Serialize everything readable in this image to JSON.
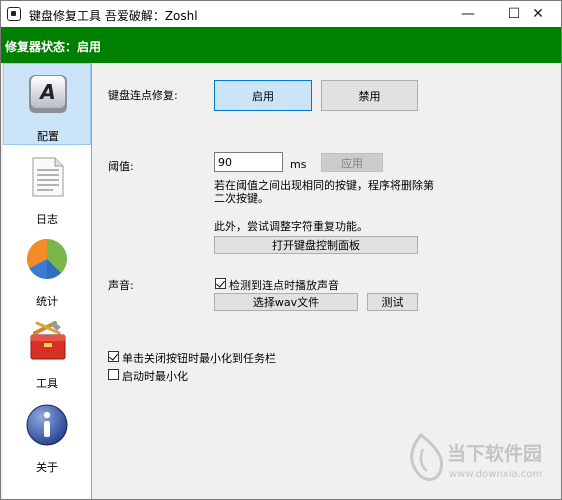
{
  "window": {
    "title": "键盘修复工具 吾爱破解：Zoshl",
    "controls": {
      "minimize": "—",
      "maximize": "☐",
      "close": "✕"
    }
  },
  "status": {
    "text": "修复器状态：启用",
    "color": "#008000"
  },
  "sidebar": {
    "items": [
      {
        "label": "配置",
        "icon": "keyboard-key-icon",
        "active": true
      },
      {
        "label": "日志",
        "icon": "document-icon",
        "active": false
      },
      {
        "label": "统计",
        "icon": "pie-chart-icon",
        "active": false
      },
      {
        "label": "工具",
        "icon": "toolbox-icon",
        "active": false
      },
      {
        "label": "关于",
        "icon": "info-icon",
        "active": false
      }
    ]
  },
  "config": {
    "chatter_label": "键盘连点修复:",
    "enable_button": "启用",
    "disable_button": "禁用",
    "threshold_label": "阈值:",
    "threshold_value": "90",
    "threshold_unit": "ms",
    "apply_button": "应用",
    "threshold_desc_line1": "若在阈值之间出现相同的按键，程序将删除第",
    "threshold_desc_line2": "二次按键。",
    "extra_note": "此外，尝试调整字符重复功能。",
    "open_keyboard_panel_button": "打开键盘控制面板",
    "sound_label": "声音:",
    "sound_checkbox_label": "检测到连点时播放声音",
    "sound_checked": true,
    "choose_wav_button": "选择wav文件",
    "test_button": "测试",
    "minimize_on_close_label": "单击关闭按钮时最小化到任务栏",
    "minimize_on_close_checked": true,
    "start_minimized_label": "启动时最小化",
    "start_minimized_checked": false
  },
  "watermark": {
    "brand": "当下软件园",
    "url": "www.downxia.com"
  }
}
